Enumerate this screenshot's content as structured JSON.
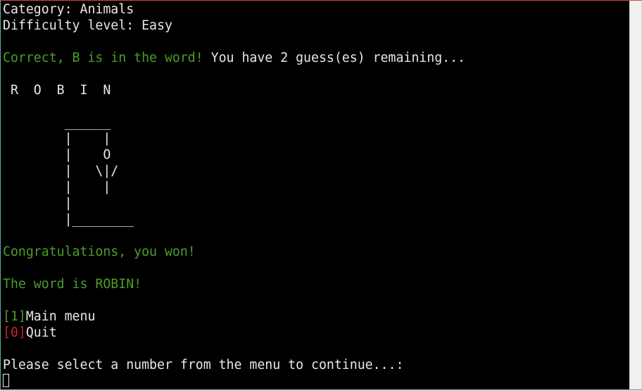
{
  "terminal": {
    "category_line": "Category: Animals",
    "difficulty_line": "Difficulty level: Easy",
    "correct_msg": "Correct, B is in the word!",
    "remaining_msg": " You have 2 guess(es) remaining...",
    "word_display": " R  O  B  I  N",
    "hangman_art": "        ______\n        |    |\n        |    O\n        |   \\|/\n        |    |\n        |\n        |________",
    "win_msg": "Congratulations, you won!",
    "word_reveal": "The word is ROBIN!",
    "menu": {
      "option1_key": "[1]",
      "option1_label": "Main menu",
      "option0_key": "[0]",
      "option0_label": "Quit"
    },
    "prompt": "Please select a number from the menu to continue...:"
  },
  "colors": {
    "background": "#000000",
    "text": "#e8e8e8",
    "success": "#4a9e2a",
    "danger": "#cc2222"
  }
}
